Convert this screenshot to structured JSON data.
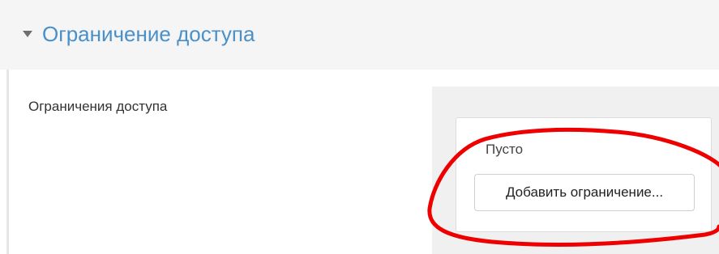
{
  "section": {
    "title": "Ограничение доступа",
    "toggle_icon": "caret-down-icon"
  },
  "field": {
    "label": "Ограничения доступа"
  },
  "restrictions": {
    "empty_text": "Пусто",
    "add_button_label": "Добавить ограничение..."
  },
  "annotation": {
    "color": "#ee0000"
  },
  "colors": {
    "header_background": "#f5f5f5",
    "title": "#4a90c8",
    "panel_background": "#f0f0f0"
  }
}
